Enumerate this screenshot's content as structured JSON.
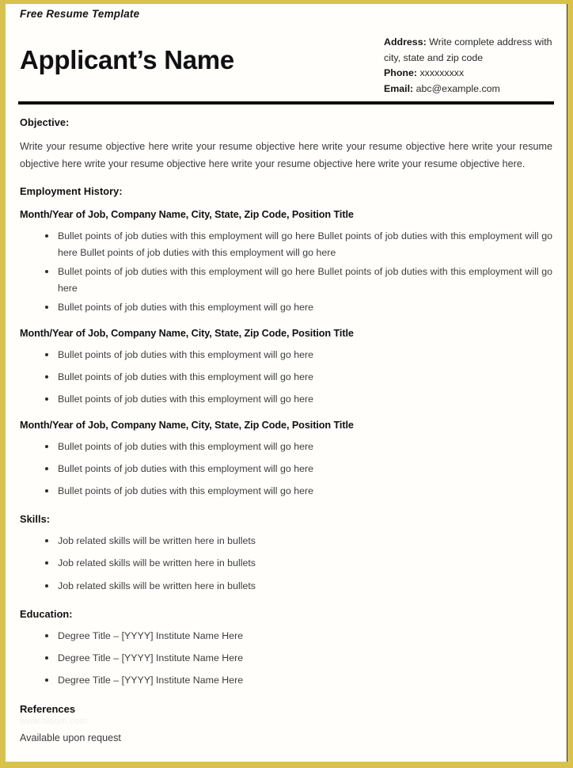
{
  "banner": {
    "label": "Free Resume Template"
  },
  "header": {
    "name": "Applicant’s Name",
    "contact": {
      "address_label": "Address:",
      "address_value": " Write complete address with city, state and zip code",
      "phone_label": "Phone:",
      "phone_value": " xxxxxxxxx",
      "email_label": "Email:",
      "email_value": " abc@example.com"
    }
  },
  "sections": {
    "objective": {
      "heading": "Objective:",
      "text": "Write your resume objective here write your resume objective here write your resume objective here write your resume objective here write your resume objective here write your resume objective here write your resume objective here."
    },
    "employment": {
      "heading": "Employment History:",
      "jobs": [
        {
          "line": "Month/Year of Job, Company Name, City, State, Zip Code, Position Title",
          "bullets": [
            "Bullet points of job duties with this employment will go here Bullet points of job duties with this employment will go here Bullet points of job duties with this employment will go here",
            "Bullet points of job duties with this employment will go here Bullet points of job duties with this employment will go here",
            "Bullet points of job duties with this employment will go here"
          ]
        },
        {
          "line": "Month/Year of Job, Company Name, City, State, Zip Code, Position Title",
          "bullets": [
            "Bullet points of job duties with this employment will go here",
            "Bullet points of job duties with this employment will go here",
            "Bullet points of job duties with this employment will go here"
          ]
        },
        {
          "line": "Month/Year of Job, Company Name, City, State, Zip Code, Position Title",
          "bullets": [
            "Bullet points of job duties with this employment will go here",
            "Bullet points of job duties with this employment will go here",
            "Bullet points of job duties with this employment will go here"
          ]
        }
      ]
    },
    "skills": {
      "heading": "Skills:",
      "bullets": [
        "Job related skills will be written here in bullets",
        "Job related skills will be written here in bullets",
        "Job related skills will be written here in bullets"
      ]
    },
    "education": {
      "heading": "Education:",
      "bullets": [
        "Degree Title – [YYYY] Institute Name Here",
        "Degree Title – [YYYY] Institute Name Here",
        "Degree Title – [YYYY] Institute Name Here"
      ]
    },
    "references": {
      "heading": "References",
      "watermark": "www.hloom.com",
      "text": "Available upon request"
    }
  },
  "colors": {
    "border_gold": "#d8c24c",
    "rule_black": "#0d0d0d",
    "page_white": "#fffefb"
  }
}
